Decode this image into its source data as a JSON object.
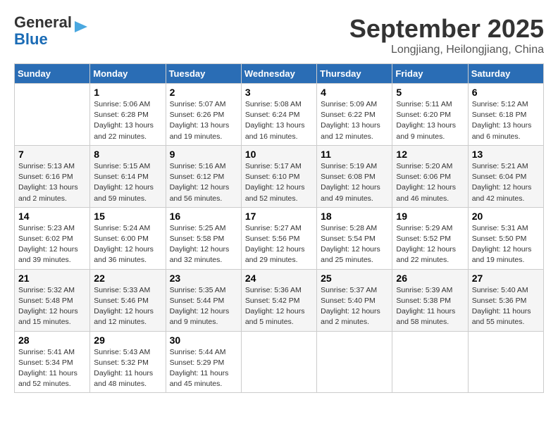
{
  "logo": {
    "line1": "General",
    "line2": "Blue"
  },
  "header": {
    "month": "September 2025",
    "location": "Longjiang, Heilongjiang, China"
  },
  "weekdays": [
    "Sunday",
    "Monday",
    "Tuesday",
    "Wednesday",
    "Thursday",
    "Friday",
    "Saturday"
  ],
  "weeks": [
    [
      {
        "day": "",
        "info": ""
      },
      {
        "day": "1",
        "info": "Sunrise: 5:06 AM\nSunset: 6:28 PM\nDaylight: 13 hours\nand 22 minutes."
      },
      {
        "day": "2",
        "info": "Sunrise: 5:07 AM\nSunset: 6:26 PM\nDaylight: 13 hours\nand 19 minutes."
      },
      {
        "day": "3",
        "info": "Sunrise: 5:08 AM\nSunset: 6:24 PM\nDaylight: 13 hours\nand 16 minutes."
      },
      {
        "day": "4",
        "info": "Sunrise: 5:09 AM\nSunset: 6:22 PM\nDaylight: 13 hours\nand 12 minutes."
      },
      {
        "day": "5",
        "info": "Sunrise: 5:11 AM\nSunset: 6:20 PM\nDaylight: 13 hours\nand 9 minutes."
      },
      {
        "day": "6",
        "info": "Sunrise: 5:12 AM\nSunset: 6:18 PM\nDaylight: 13 hours\nand 6 minutes."
      }
    ],
    [
      {
        "day": "7",
        "info": "Sunrise: 5:13 AM\nSunset: 6:16 PM\nDaylight: 13 hours\nand 2 minutes."
      },
      {
        "day": "8",
        "info": "Sunrise: 5:15 AM\nSunset: 6:14 PM\nDaylight: 12 hours\nand 59 minutes."
      },
      {
        "day": "9",
        "info": "Sunrise: 5:16 AM\nSunset: 6:12 PM\nDaylight: 12 hours\nand 56 minutes."
      },
      {
        "day": "10",
        "info": "Sunrise: 5:17 AM\nSunset: 6:10 PM\nDaylight: 12 hours\nand 52 minutes."
      },
      {
        "day": "11",
        "info": "Sunrise: 5:19 AM\nSunset: 6:08 PM\nDaylight: 12 hours\nand 49 minutes."
      },
      {
        "day": "12",
        "info": "Sunrise: 5:20 AM\nSunset: 6:06 PM\nDaylight: 12 hours\nand 46 minutes."
      },
      {
        "day": "13",
        "info": "Sunrise: 5:21 AM\nSunset: 6:04 PM\nDaylight: 12 hours\nand 42 minutes."
      }
    ],
    [
      {
        "day": "14",
        "info": "Sunrise: 5:23 AM\nSunset: 6:02 PM\nDaylight: 12 hours\nand 39 minutes."
      },
      {
        "day": "15",
        "info": "Sunrise: 5:24 AM\nSunset: 6:00 PM\nDaylight: 12 hours\nand 36 minutes."
      },
      {
        "day": "16",
        "info": "Sunrise: 5:25 AM\nSunset: 5:58 PM\nDaylight: 12 hours\nand 32 minutes."
      },
      {
        "day": "17",
        "info": "Sunrise: 5:27 AM\nSunset: 5:56 PM\nDaylight: 12 hours\nand 29 minutes."
      },
      {
        "day": "18",
        "info": "Sunrise: 5:28 AM\nSunset: 5:54 PM\nDaylight: 12 hours\nand 25 minutes."
      },
      {
        "day": "19",
        "info": "Sunrise: 5:29 AM\nSunset: 5:52 PM\nDaylight: 12 hours\nand 22 minutes."
      },
      {
        "day": "20",
        "info": "Sunrise: 5:31 AM\nSunset: 5:50 PM\nDaylight: 12 hours\nand 19 minutes."
      }
    ],
    [
      {
        "day": "21",
        "info": "Sunrise: 5:32 AM\nSunset: 5:48 PM\nDaylight: 12 hours\nand 15 minutes."
      },
      {
        "day": "22",
        "info": "Sunrise: 5:33 AM\nSunset: 5:46 PM\nDaylight: 12 hours\nand 12 minutes."
      },
      {
        "day": "23",
        "info": "Sunrise: 5:35 AM\nSunset: 5:44 PM\nDaylight: 12 hours\nand 9 minutes."
      },
      {
        "day": "24",
        "info": "Sunrise: 5:36 AM\nSunset: 5:42 PM\nDaylight: 12 hours\nand 5 minutes."
      },
      {
        "day": "25",
        "info": "Sunrise: 5:37 AM\nSunset: 5:40 PM\nDaylight: 12 hours\nand 2 minutes."
      },
      {
        "day": "26",
        "info": "Sunrise: 5:39 AM\nSunset: 5:38 PM\nDaylight: 11 hours\nand 58 minutes."
      },
      {
        "day": "27",
        "info": "Sunrise: 5:40 AM\nSunset: 5:36 PM\nDaylight: 11 hours\nand 55 minutes."
      }
    ],
    [
      {
        "day": "28",
        "info": "Sunrise: 5:41 AM\nSunset: 5:34 PM\nDaylight: 11 hours\nand 52 minutes."
      },
      {
        "day": "29",
        "info": "Sunrise: 5:43 AM\nSunset: 5:32 PM\nDaylight: 11 hours\nand 48 minutes."
      },
      {
        "day": "30",
        "info": "Sunrise: 5:44 AM\nSunset: 5:29 PM\nDaylight: 11 hours\nand 45 minutes."
      },
      {
        "day": "",
        "info": ""
      },
      {
        "day": "",
        "info": ""
      },
      {
        "day": "",
        "info": ""
      },
      {
        "day": "",
        "info": ""
      }
    ]
  ]
}
